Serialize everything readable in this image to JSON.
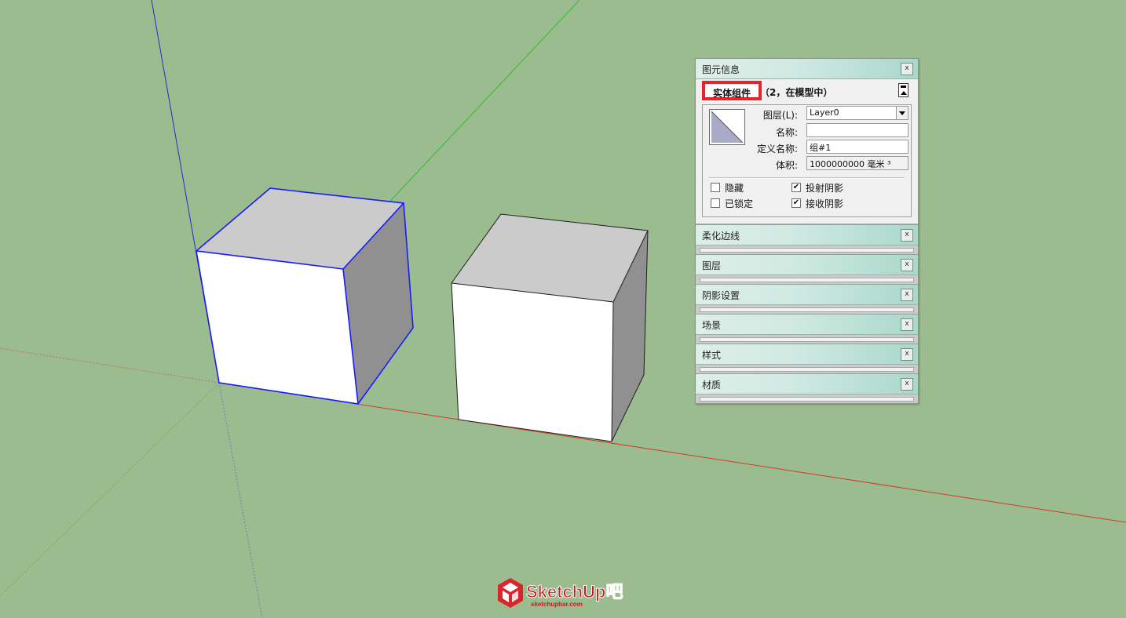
{
  "entity_info": {
    "panel_title": "图元信息",
    "type_label": "实体组件",
    "count_text": "（2，在模型中）",
    "layer_label": "图层(L):",
    "layer_value": "Layer0",
    "name_label": "名称:",
    "name_value": "",
    "definition_label": "定义名称:",
    "definition_value": "组#1",
    "volume_label": "体积:",
    "volume_value": "1000000000 毫米 ³",
    "hidden_label": "隐藏",
    "hidden_checked": false,
    "locked_label": "已锁定",
    "locked_checked": false,
    "cast_shadows_label": "投射阴影",
    "cast_shadows_checked": true,
    "receive_shadows_label": "接收阴影",
    "receive_shadows_checked": true
  },
  "panels": [
    {
      "title": "柔化边线"
    },
    {
      "title": "图层"
    },
    {
      "title": "阴影设置"
    },
    {
      "title": "场景"
    },
    {
      "title": "样式"
    },
    {
      "title": "材质"
    }
  ],
  "close_glyph": "x",
  "check_glyph": "✔",
  "watermark": {
    "brand": "SketchUp吧",
    "url": "sketchupbar.com"
  },
  "colors": {
    "background": "#9bbc8e",
    "selection": "#1a1aff",
    "highlight": "#e8232a",
    "axis_red": "#d23a2a",
    "axis_green": "#2fbf2f",
    "axis_blue": "#2a2ad0"
  }
}
